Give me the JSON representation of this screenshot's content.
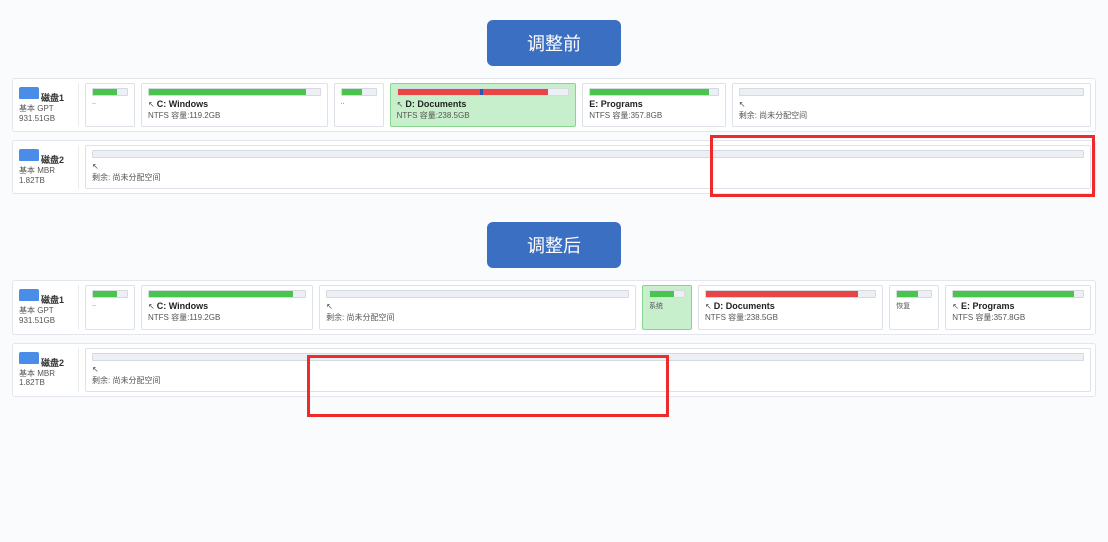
{
  "titles": {
    "before": "调整前",
    "after": "调整后"
  },
  "before": {
    "disk1": {
      "label": "磁盘1",
      "sub1": "基本 GPT",
      "sub2": "931.51GB",
      "arrow_glyph": "↖",
      "c": {
        "name": "C: Windows",
        "info": "NTFS 容量:119.2GB"
      },
      "d": {
        "name": "D: Documents",
        "info": "NTFS 容量:238.5GB"
      },
      "e": {
        "name": "E: Programs",
        "info": "NTFS 容量:357.8GB"
      },
      "free": {
        "info": "剩余: 尚未分配空间",
        "name": ""
      }
    },
    "disk2": {
      "label": "磁盘2",
      "sub1": "基本 MBR",
      "sub2": "1.82TB",
      "arrow_glyph": "↖",
      "free": {
        "info": "剩余: 尚未分配空间"
      }
    }
  },
  "after": {
    "disk1": {
      "label": "磁盘1",
      "sub1": "基本 GPT",
      "sub2": "931.51GB",
      "arrow_glyph": "↖",
      "c": {
        "name": "C: Windows",
        "info": "NTFS 容量:119.2GB"
      },
      "free": {
        "info": "剩余: 尚未分配空间"
      },
      "d": {
        "name": "D: Documents",
        "info": "NTFS 容量:238.5GB"
      },
      "e": {
        "name": "E: Programs",
        "info": "NTFS 容量:357.8GB"
      },
      "col_small1": "系统",
      "col_small2": "恢复"
    },
    "disk2": {
      "label": "磁盘2",
      "sub1": "基本 MBR",
      "sub2": "1.82TB",
      "arrow_glyph": "↖",
      "free": {
        "info": "剩余: 尚未分配空间"
      }
    }
  }
}
